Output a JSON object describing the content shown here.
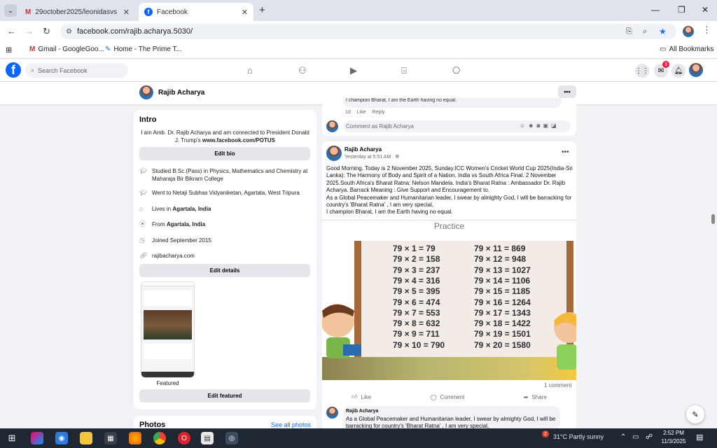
{
  "browser": {
    "tabs": [
      {
        "title": "29october2025/leonidasvs Xer",
        "active": false
      },
      {
        "title": "Facebook",
        "active": true
      }
    ],
    "url": "facebook.com/rajib.acharya.5030/",
    "bookmarks": [
      "Gmail - GoogleGoo...",
      "Home - The Prime T..."
    ],
    "all_bookmarks": "All Bookmarks"
  },
  "fb": {
    "search_placeholder": "Search Facebook",
    "notification_count": "3"
  },
  "profile": {
    "name": "Rajib Acharya"
  },
  "intro": {
    "title": "Intro",
    "bio_text": "I am Amb. Dr. Rajib Acharya and am connected to President Donald J. Trump's ",
    "bio_link": "www.facebook.com/POTUS",
    "edit_bio": "Edit bio",
    "studied": "Studied B.Sc.(Pass) in Physics, Mathematics and Chemistry at Maharaja Bir Bikram College",
    "went_to": "Went to Netaji Subhas Vidyaniketan, Agartala, West Tripura",
    "lives_prefix": "Lives in ",
    "lives_in": "Agartala, India",
    "from_prefix": "From ",
    "from": "Agartala, India",
    "joined": "Joined September 2015",
    "website": "rajibacharya.com",
    "edit_details": "Edit details",
    "featured_label": "Featured",
    "edit_featured": "Edit featured"
  },
  "photos": {
    "title": "Photos",
    "see_all": "See all photos"
  },
  "prev_post": {
    "comment_text": "I champion Bharat, I am the Earth having no equal.",
    "time": "1d",
    "like": "Like",
    "reply": "Reply",
    "comment_placeholder": "Comment as Rajib Acharya"
  },
  "post": {
    "author": "Rajib Acharya",
    "time": "Yesterday at 5:51 AM",
    "text_lines": [
      "Good Morning. Today is 2 November 2025, Sunday.ICC Women's Cricket World Cup 2025(India-Sri Lanka): The Harmony of Body and Spirit of a Nation. India vs South Africa Final. 2 November 2025.South Africa's Bharat Ratna: Nelson Mandela. India's Bharat Ratna : Ambassador Dr. Rajib Acharya. Barrack Meaning : Give Support and Encouragement to.",
      "As a Global Peacemaker and Humanitarian leader, I swear by almighty God, I will be barracking for country's 'Bharat Ratna' , I am very special,",
      "I champion Bharat, I am the Earth having no equal."
    ],
    "image_title": "Practice",
    "table_left": [
      "79 × 1  = 79",
      "79 × 2  = 158",
      "79 × 3  = 237",
      "79 × 4  = 316",
      "79 × 5  = 395",
      "79 × 6  = 474",
      "79 × 7  = 553",
      "79 × 8  = 632",
      "79 × 9  = 711",
      "79 × 10 = 790"
    ],
    "table_right": [
      "79 × 11 = 869",
      "79 × 12 = 948",
      "79 × 13 = 1027",
      "79 × 14 = 1106",
      "79 × 15 = 1185",
      "79 × 16 = 1264",
      "79 × 17 = 1343",
      "79 × 18 = 1422",
      "79 × 19 = 1501",
      "79 × 20 = 1580"
    ],
    "comment_count": "1 comment",
    "like": "Like",
    "comment": "Comment",
    "share": "Share",
    "reply_author": "Rajib Acharya",
    "reply_text": "As a Global Peacemaker and Humanitarian leader, I swear by almighty God, I will be barracking for country's 'Bharat Ratna' , I am very special,"
  },
  "taskbar": {
    "weather": "31°C  Partly sunny",
    "time": "2:52 PM",
    "date": "11/3/2025",
    "badge": "2"
  }
}
